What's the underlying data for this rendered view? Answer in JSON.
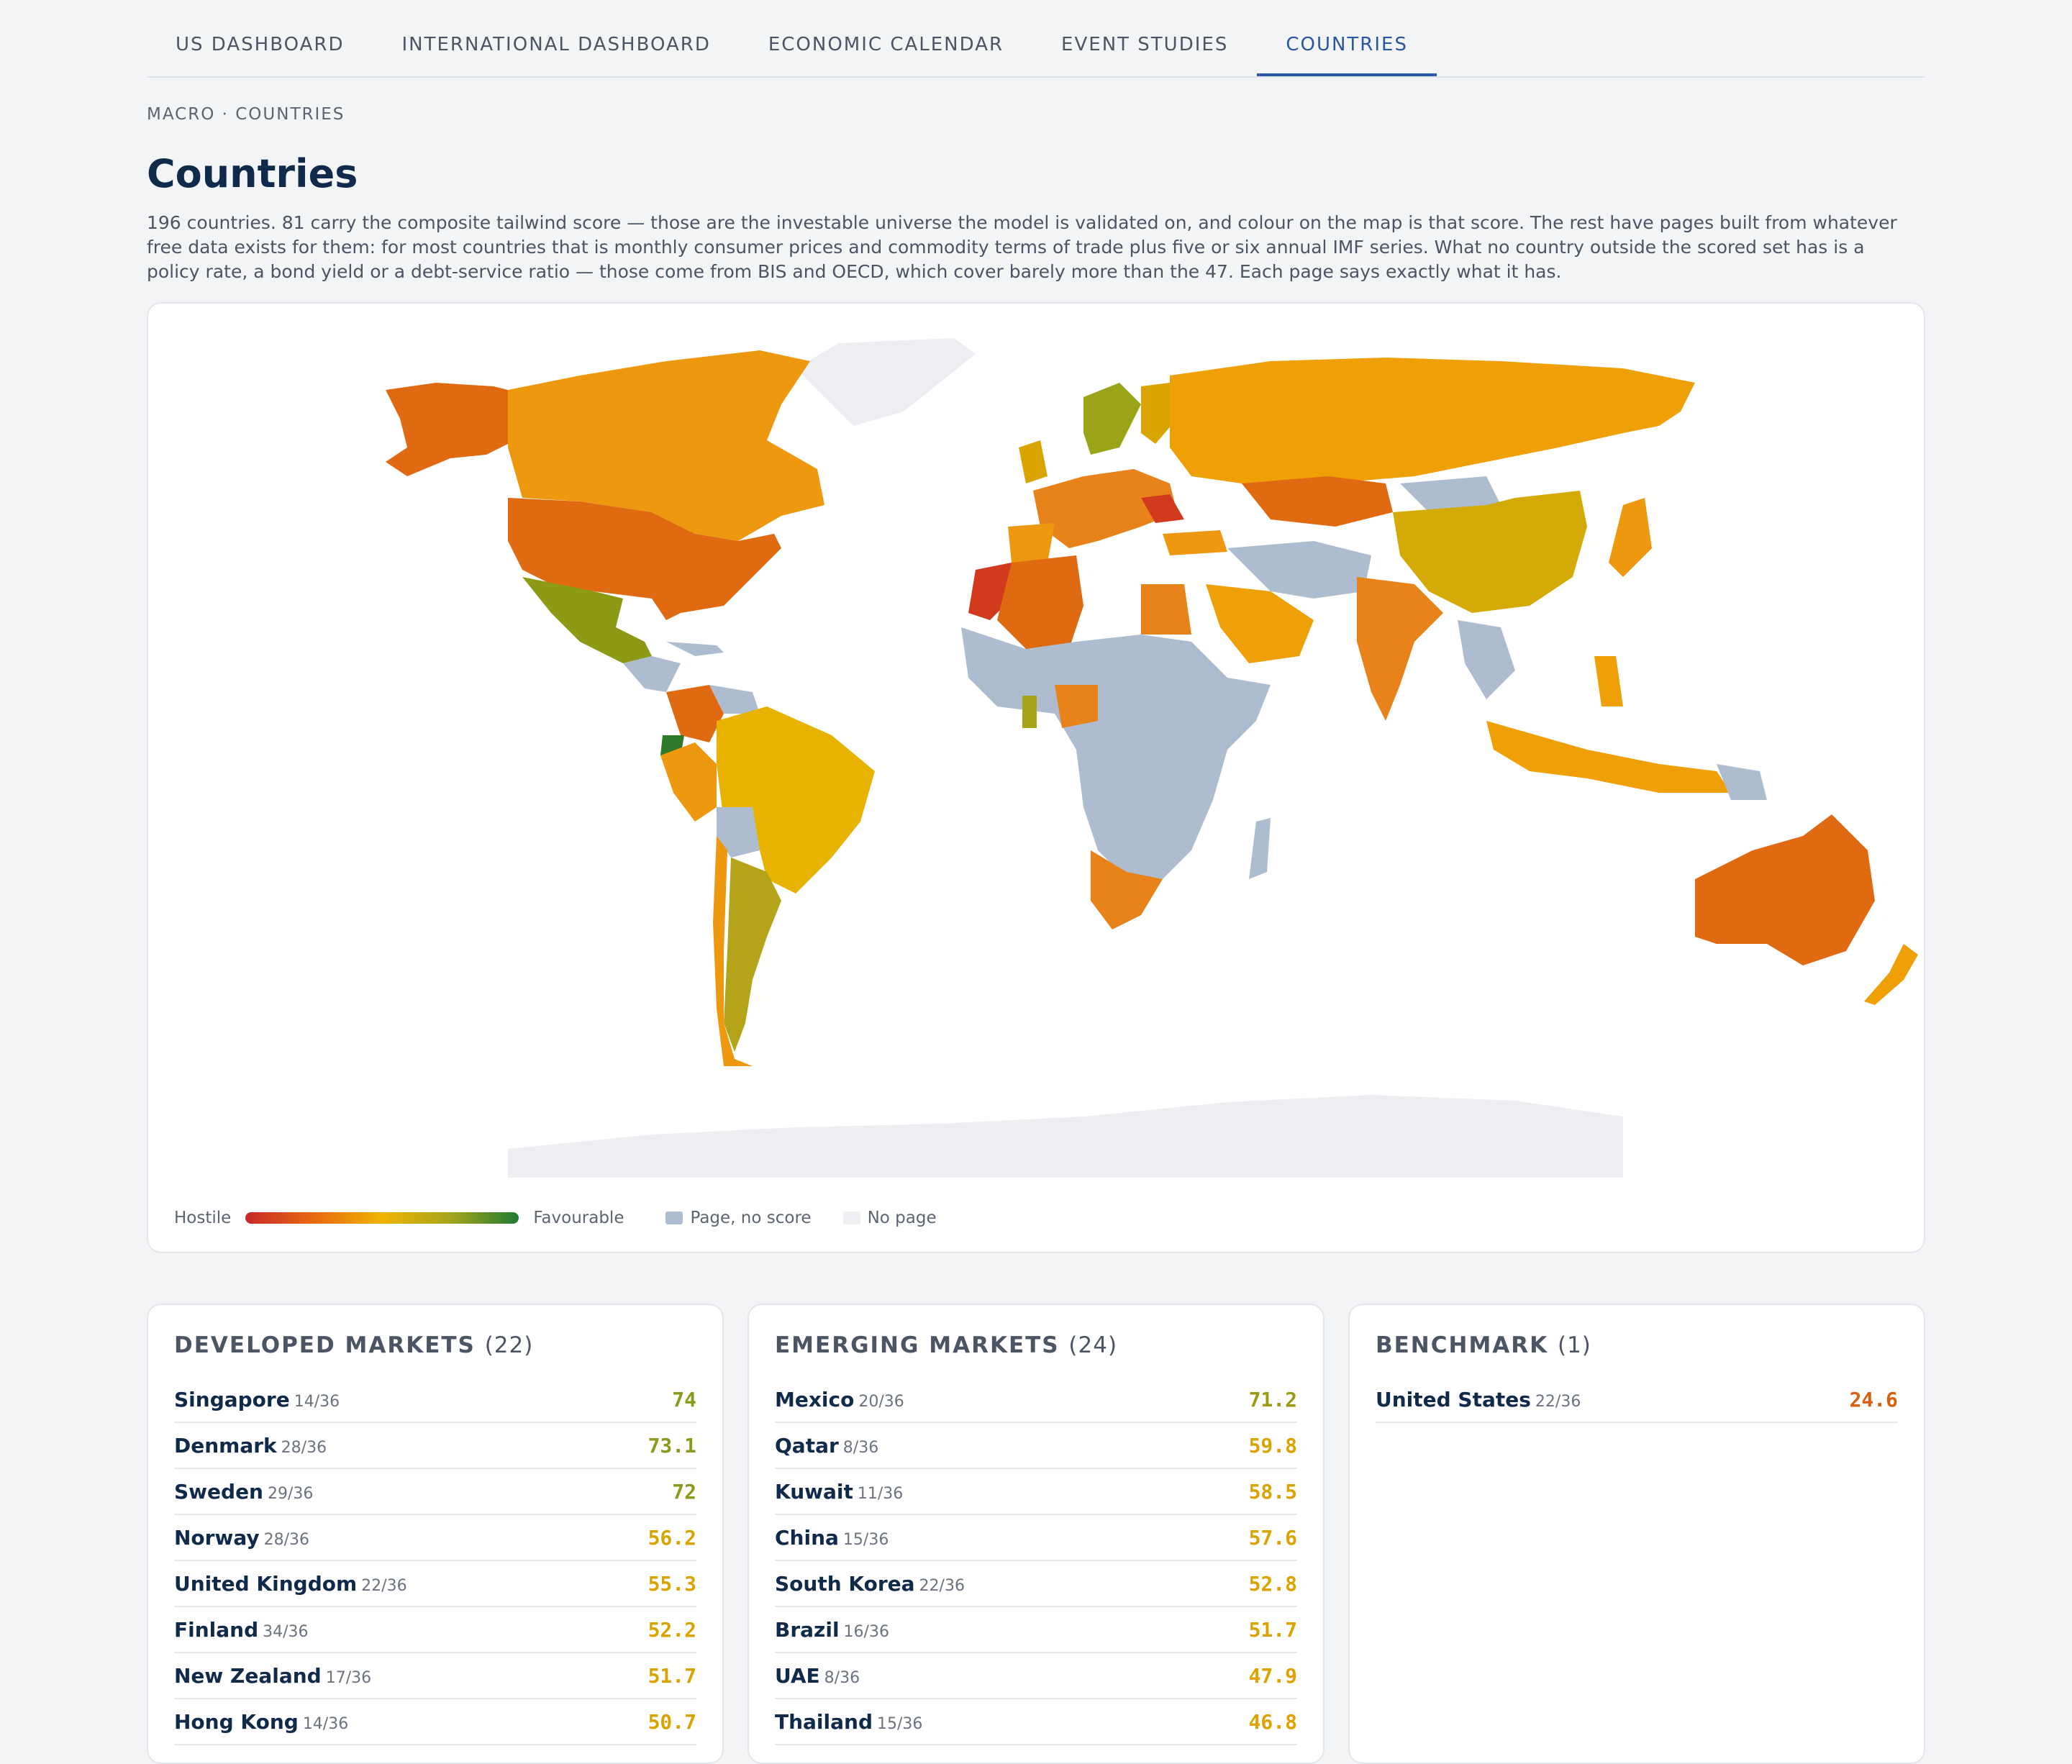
{
  "tabs": [
    {
      "label": "US DASHBOARD"
    },
    {
      "label": "INTERNATIONAL DASHBOARD"
    },
    {
      "label": "ECONOMIC CALENDAR"
    },
    {
      "label": "EVENT STUDIES"
    },
    {
      "label": "COUNTRIES"
    }
  ],
  "breadcrumb": "MACRO · COUNTRIES",
  "title": "Countries",
  "description": "196 countries. 81 carry the composite tailwind score — those are the investable universe the model is validated on, and colour on the map is that score. The rest have pages built from whatever free data exists for them: for most countries that is monthly consumer prices and commodity terms of trade plus five or six annual IMF series. What no country outside the scored set has is a policy rate, a bond yield or a debt-service ratio — those come from BIS and OECD, which cover barely more than the 47. Each page says exactly what it has.",
  "legend": {
    "hostile": "Hostile",
    "favourable": "Favourable",
    "page_no_score": "Page, no score",
    "no_page": "No page"
  },
  "colors": {
    "accent": "#2b57a0",
    "hostile": "#c62828",
    "orange": "#e8690f",
    "amber": "#f0b400",
    "olive": "#a6a51c",
    "favourable": "#1f7a32",
    "page_no_score": "#aebcd0",
    "no_page": "#eceef1"
  },
  "lists": [
    {
      "title": "DEVELOPED MARKETS",
      "count": "(22)",
      "rows": [
        {
          "name": "Singapore",
          "frac": "14/36",
          "score": "74",
          "color": "#8a9a1a"
        },
        {
          "name": "Denmark",
          "frac": "28/36",
          "score": "73.1",
          "color": "#8a9a1a"
        },
        {
          "name": "Sweden",
          "frac": "29/36",
          "score": "72",
          "color": "#8a9a1a"
        },
        {
          "name": "Norway",
          "frac": "28/36",
          "score": "56.2",
          "color": "#d9a400"
        },
        {
          "name": "United Kingdom",
          "frac": "22/36",
          "score": "55.3",
          "color": "#d9a400"
        },
        {
          "name": "Finland",
          "frac": "34/36",
          "score": "52.2",
          "color": "#d9a400"
        },
        {
          "name": "New Zealand",
          "frac": "17/36",
          "score": "51.7",
          "color": "#d9a400"
        },
        {
          "name": "Hong Kong",
          "frac": "14/36",
          "score": "50.7",
          "color": "#d9a400"
        }
      ]
    },
    {
      "title": "EMERGING MARKETS",
      "count": "(24)",
      "rows": [
        {
          "name": "Mexico",
          "frac": "20/36",
          "score": "71.2",
          "color": "#9a9a14"
        },
        {
          "name": "Qatar",
          "frac": "8/36",
          "score": "59.8",
          "color": "#d9a400"
        },
        {
          "name": "Kuwait",
          "frac": "11/36",
          "score": "58.5",
          "color": "#d9a400"
        },
        {
          "name": "China",
          "frac": "15/36",
          "score": "57.6",
          "color": "#d9a400"
        },
        {
          "name": "South Korea",
          "frac": "22/36",
          "score": "52.8",
          "color": "#d9a400"
        },
        {
          "name": "Brazil",
          "frac": "16/36",
          "score": "51.7",
          "color": "#d9a400"
        },
        {
          "name": "UAE",
          "frac": "8/36",
          "score": "47.9",
          "color": "#e0a200"
        },
        {
          "name": "Thailand",
          "frac": "15/36",
          "score": "46.8",
          "color": "#e0a200"
        }
      ]
    },
    {
      "title": "BENCHMARK",
      "count": "(1)",
      "rows": [
        {
          "name": "United States",
          "frac": "22/36",
          "score": "24.6",
          "color": "#d9600f"
        }
      ]
    }
  ]
}
